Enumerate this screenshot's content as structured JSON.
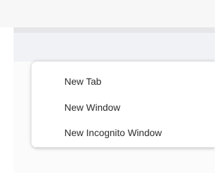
{
  "menu": {
    "items": [
      {
        "label": "New Tab"
      },
      {
        "label": "New Window"
      },
      {
        "label": "New Incognito Window"
      }
    ]
  },
  "colors": {
    "toolbar": "#f0f2f6",
    "tab_strip": "#e6e6e8",
    "menu_bg": "#ffffff",
    "menu_text": "#2b2b2b"
  }
}
